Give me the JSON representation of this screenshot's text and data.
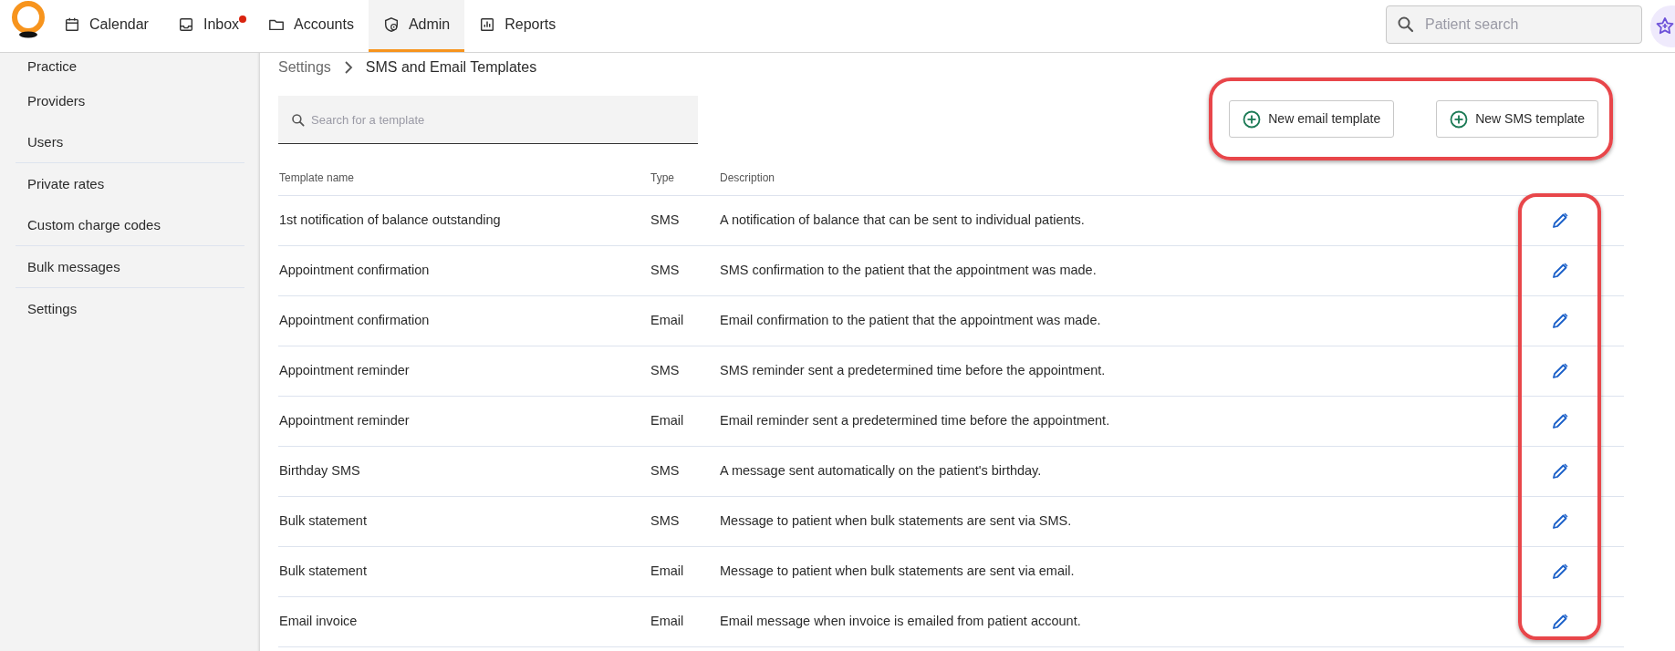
{
  "nav": {
    "items": [
      {
        "label": "Calendar",
        "selected": false,
        "notification": false
      },
      {
        "label": "Inbox",
        "selected": false,
        "notification": true
      },
      {
        "label": "Accounts",
        "selected": false,
        "notification": false
      },
      {
        "label": "Admin",
        "selected": true,
        "notification": false
      },
      {
        "label": "Reports",
        "selected": false,
        "notification": false
      }
    ],
    "search": {
      "placeholder": "Patient search"
    }
  },
  "sidebar": {
    "groups": [
      [
        "Practice",
        "Providers",
        "Users"
      ],
      [
        "Private rates",
        "Custom charge codes"
      ],
      [
        "Bulk messages"
      ],
      [
        "Settings"
      ]
    ]
  },
  "breadcrumb": [
    "Settings",
    "SMS and Email Templates"
  ],
  "template_search": {
    "placeholder": "Search for a template"
  },
  "buttons": [
    "New email template",
    "New SMS template"
  ],
  "buttons_highlighted": true,
  "edit_column_highlighted": true,
  "table": {
    "columns": [
      "Template name",
      "Type",
      "Description"
    ],
    "rows": [
      {
        "name": "1st notification of balance outstanding",
        "type": "SMS",
        "description": "A notification of balance that can be sent to individual patients."
      },
      {
        "name": "Appointment confirmation",
        "type": "SMS",
        "description": "SMS confirmation to the patient that the appointment was made."
      },
      {
        "name": "Appointment confirmation",
        "type": "Email",
        "description": "Email confirmation to the patient that the appointment was made."
      },
      {
        "name": "Appointment reminder",
        "type": "SMS",
        "description": "SMS reminder sent a predetermined time before the appointment."
      },
      {
        "name": "Appointment reminder",
        "type": "Email",
        "description": "Email reminder sent a predetermined time before the appointment."
      },
      {
        "name": "Birthday SMS",
        "type": "SMS",
        "description": "A message sent automatically on the patient's birthday."
      },
      {
        "name": "Bulk statement",
        "type": "SMS",
        "description": "Message to patient when bulk statements are sent via SMS."
      },
      {
        "name": "Bulk statement",
        "type": "Email",
        "description": "Message to patient when bulk statements are sent via email."
      },
      {
        "name": "Email invoice",
        "type": "Email",
        "description": "Email message when invoice is emailed from patient account."
      }
    ]
  }
}
